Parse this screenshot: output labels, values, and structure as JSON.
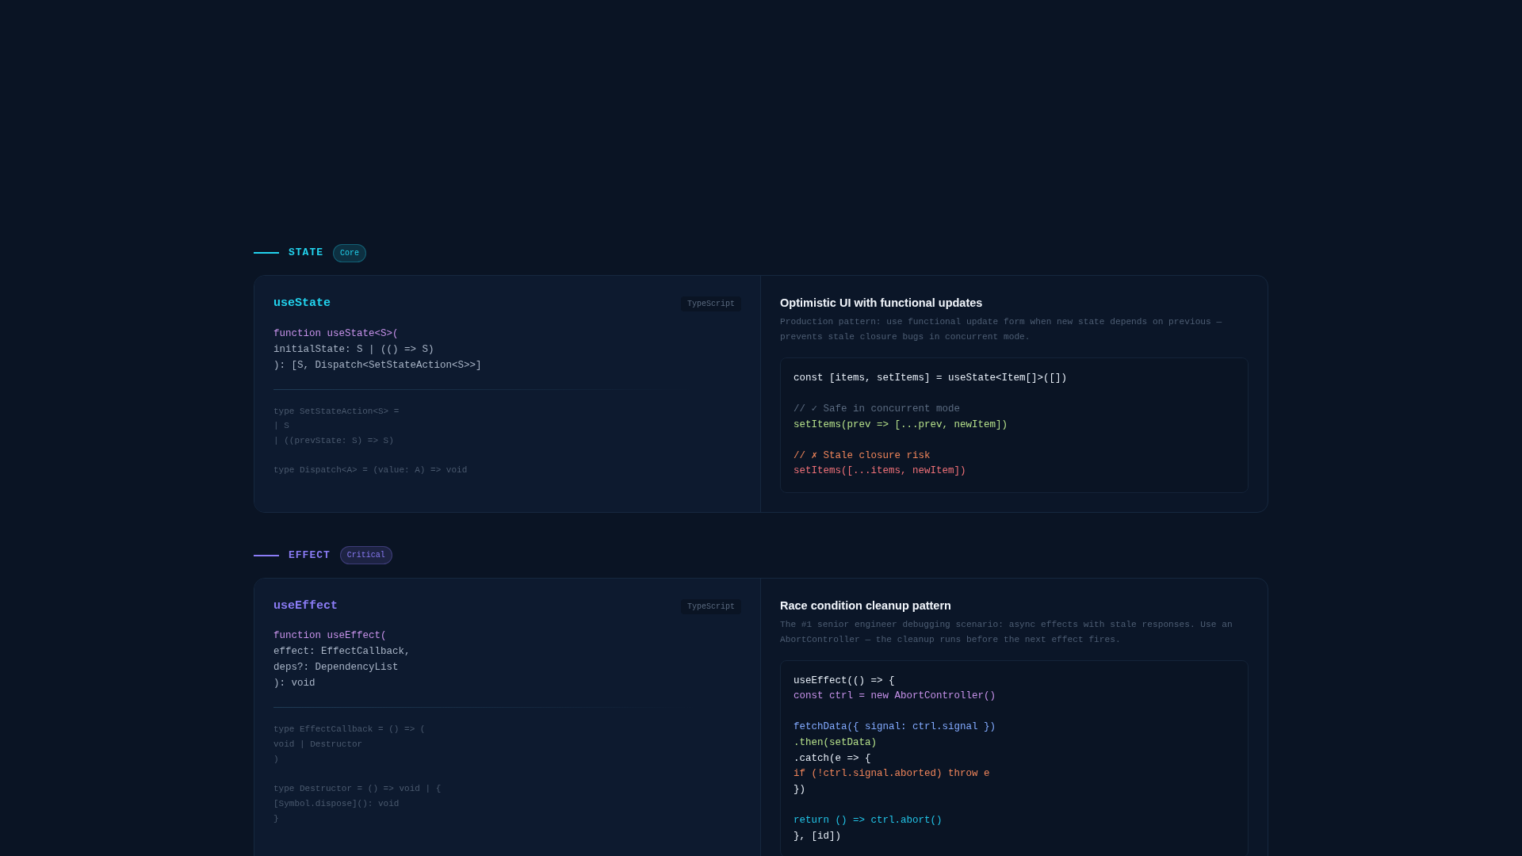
{
  "sections": [
    {
      "label": "STATE",
      "badge": "Core",
      "color": "#22d3ee",
      "card": {
        "hook": "useState",
        "language": "TypeScript",
        "signature": [
          {
            "kind": "keyword",
            "text": "function useState<S>("
          },
          {
            "kind": "plain",
            "text": "initialState: S | (() => S)"
          },
          {
            "kind": "plain",
            "text": "): [S, Dispatch<SetStateAction<S>>]"
          }
        ],
        "types": [
          {
            "kind": "text",
            "text": "type SetStateAction<S> ="
          },
          {
            "kind": "text",
            "text": "| S"
          },
          {
            "kind": "text",
            "text": "| ((prevState: S) => S)"
          },
          {
            "kind": "blank"
          },
          {
            "kind": "text",
            "text": "type Dispatch<A> = (value: A) => void"
          }
        ],
        "pattern_title": "Optimistic UI with functional updates",
        "pattern_text": "Production pattern: use functional update form when new state depends on previous — prevents stale closure bugs in concurrent mode.",
        "example": [
          {
            "kind": "plain",
            "text": "const [items, setItems] = useState<Item[]>([])"
          },
          {
            "kind": "blank"
          },
          {
            "kind": "comment",
            "text": "// ✓ Safe in concurrent mode"
          },
          {
            "kind": "green",
            "text": "setItems(prev => [...prev, newItem])"
          },
          {
            "kind": "blank"
          },
          {
            "kind": "orange",
            "text": "// ✗ Stale closure risk"
          },
          {
            "kind": "red",
            "text": "setItems([...items, newItem])"
          }
        ]
      }
    },
    {
      "label": "EFFECT",
      "badge": "Critical",
      "color": "#8b7cf6",
      "card": {
        "hook": "useEffect",
        "language": "TypeScript",
        "signature": [
          {
            "kind": "keyword",
            "text": "function useEffect("
          },
          {
            "kind": "plain",
            "text": "effect: EffectCallback,"
          },
          {
            "kind": "plain",
            "text": "deps?: DependencyList"
          },
          {
            "kind": "plain",
            "text": "): void"
          }
        ],
        "types": [
          {
            "kind": "text",
            "text": "type EffectCallback = () => ("
          },
          {
            "kind": "text",
            "text": "void | Destructor"
          },
          {
            "kind": "text",
            "text": ")"
          },
          {
            "kind": "blank"
          },
          {
            "kind": "text",
            "text": "type Destructor = () => void | {"
          },
          {
            "kind": "text",
            "text": "[Symbol.dispose](): void"
          },
          {
            "kind": "text",
            "text": "}"
          }
        ],
        "pattern_title": "Race condition cleanup pattern",
        "pattern_text": "The #1 senior engineer debugging scenario: async effects with stale responses. Use an AbortController — the cleanup runs before the next effect fires.",
        "example": [
          {
            "kind": "plain",
            "text": "useEffect(() => {"
          },
          {
            "kind": "keyword",
            "text": "const ctrl = new AbortController()"
          },
          {
            "kind": "blank"
          },
          {
            "kind": "blue",
            "text": "fetchData({ signal: ctrl.signal })"
          },
          {
            "kind": "green",
            "text": ".then(setData)"
          },
          {
            "kind": "plain",
            "text": ".catch(e => {"
          },
          {
            "kind": "orange",
            "text": "if (!ctrl.signal.aborted) throw e"
          },
          {
            "kind": "plain",
            "text": "})"
          },
          {
            "kind": "blank"
          },
          {
            "kind": "cyan",
            "text": "return () => ctrl.abort()"
          },
          {
            "kind": "plain",
            "text": "}, [id])"
          }
        ]
      }
    }
  ]
}
